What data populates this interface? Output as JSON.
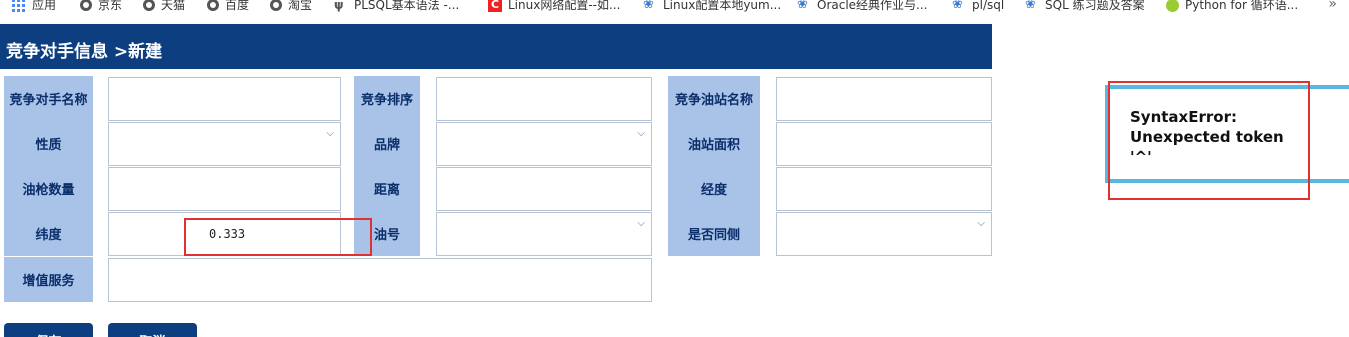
{
  "bookmarks": [
    {
      "label": "应用",
      "icon": "apps-icon"
    },
    {
      "label": "京东",
      "icon": "globe-icon"
    },
    {
      "label": "天猫",
      "icon": "globe-icon"
    },
    {
      "label": "百度",
      "icon": "globe-icon"
    },
    {
      "label": "淘宝",
      "icon": "globe-icon"
    },
    {
      "label": "PLSQL基本语法 -...",
      "icon": "plsql-icon"
    },
    {
      "label": "Linux网络配置--如...",
      "icon": "csdn-icon"
    },
    {
      "label": "Linux配置本地yum...",
      "icon": "paw-icon"
    },
    {
      "label": "Oracle经典作业与...",
      "icon": "paw-icon"
    },
    {
      "label": "pl/sql",
      "icon": "paw-icon"
    },
    {
      "label": "SQL 练习题及答案",
      "icon": "paw-icon"
    },
    {
      "label": "Python for 循环语...",
      "icon": "python-icon"
    }
  ],
  "page": {
    "title": "竞争对手信息 >新建"
  },
  "form": {
    "labels": {
      "competitor_name": "竞争对手名称",
      "competitor_rank": "竞争排序",
      "station_name": "竞争油站名称",
      "nature": "性质",
      "brand": "品牌",
      "station_area": "油站面积",
      "gun_count": "油枪数量",
      "distance": "距离",
      "longitude": "经度",
      "latitude": "纬度",
      "oil_type": "油号",
      "same_side": "是否同侧",
      "value_added": "增值服务"
    },
    "values": {
      "latitude": "0.333"
    }
  },
  "buttons": {
    "save": "保存",
    "cancel": "取消"
  },
  "error": {
    "message": "SyntaxError: Unexpected token '^'"
  }
}
